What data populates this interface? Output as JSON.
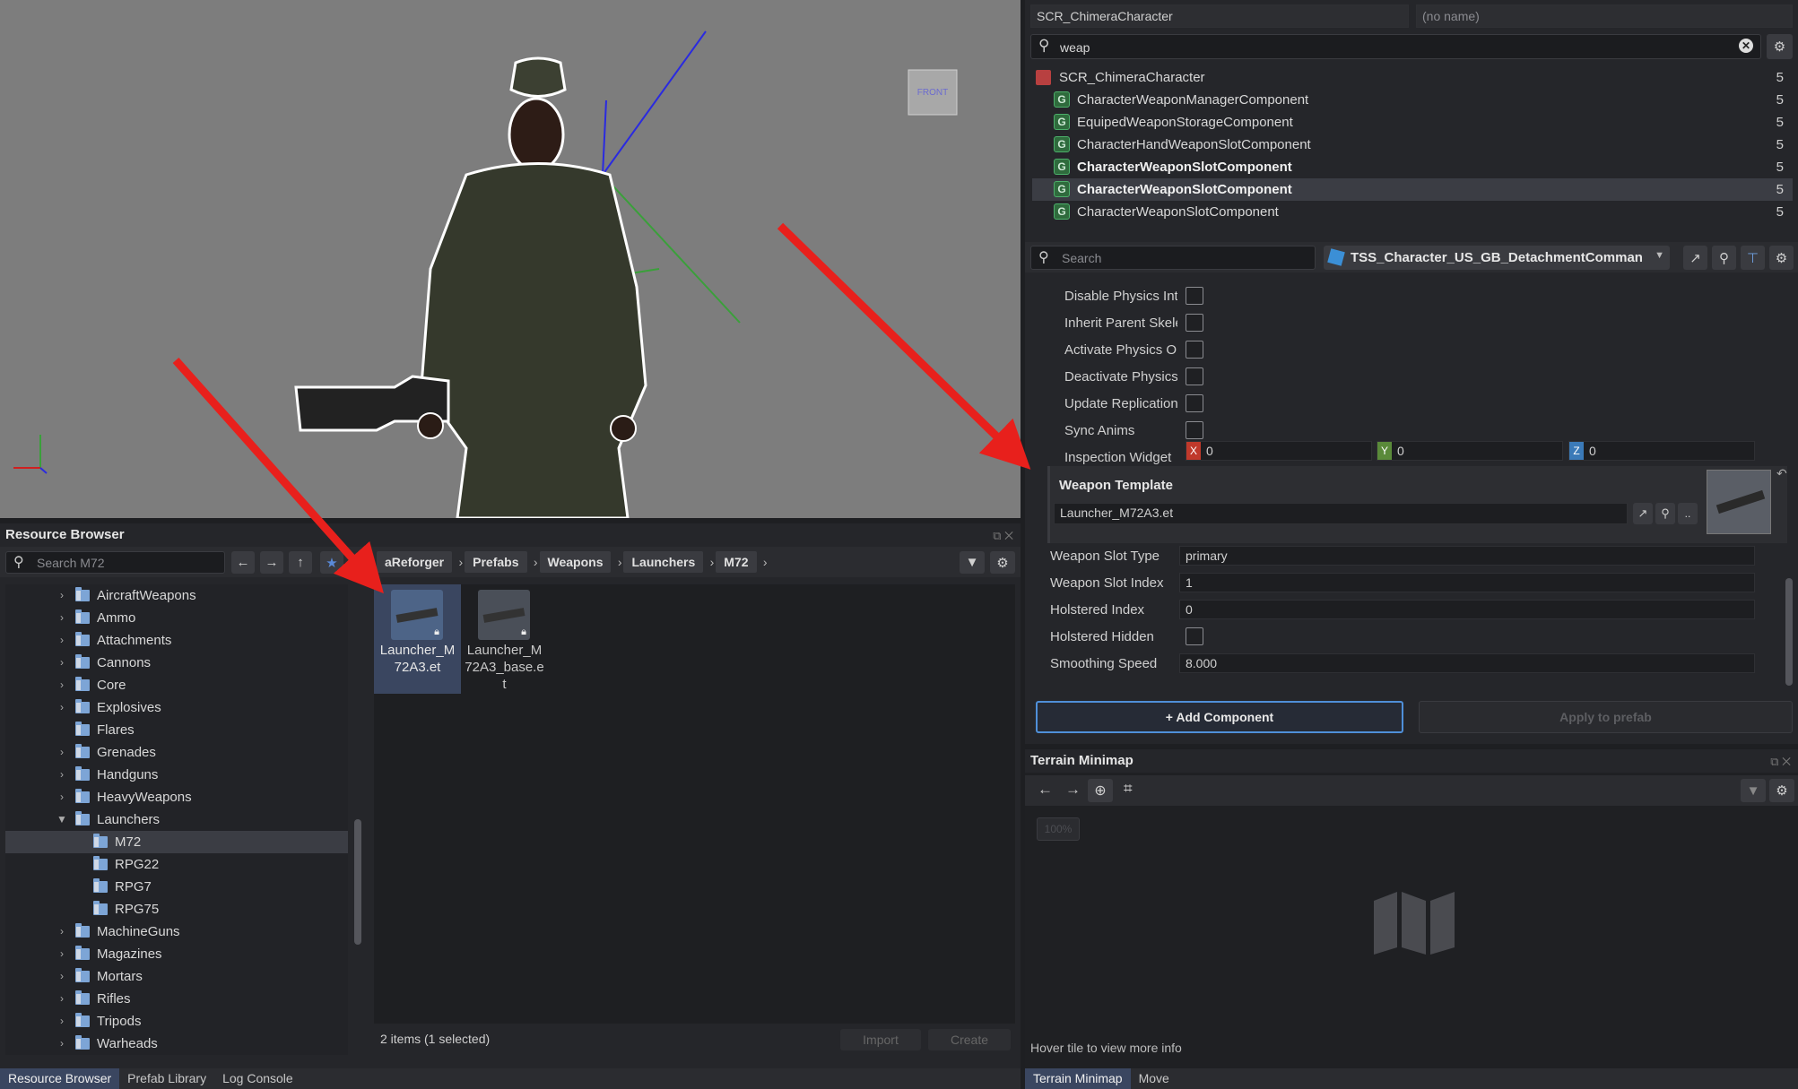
{
  "viewport": {
    "front_label": "FRONT",
    "colors": {
      "bg": "#7d7d7d",
      "annotation_arrow": "#e8201c"
    }
  },
  "resource_browser": {
    "title": "Resource Browser",
    "search_placeholder": "Search M72",
    "breadcrumb": [
      "aReforger",
      "Prefabs",
      "Weapons",
      "Launchers",
      "M72"
    ],
    "tree": [
      {
        "label": "AircraftWeapons",
        "expandable": true,
        "level": 0
      },
      {
        "label": "Ammo",
        "expandable": true,
        "level": 0
      },
      {
        "label": "Attachments",
        "expandable": true,
        "level": 0
      },
      {
        "label": "Cannons",
        "expandable": true,
        "level": 0
      },
      {
        "label": "Core",
        "expandable": true,
        "level": 0
      },
      {
        "label": "Explosives",
        "expandable": true,
        "level": 0
      },
      {
        "label": "Flares",
        "expandable": false,
        "level": 0
      },
      {
        "label": "Grenades",
        "expandable": true,
        "level": 0
      },
      {
        "label": "Handguns",
        "expandable": true,
        "level": 0
      },
      {
        "label": "HeavyWeapons",
        "expandable": true,
        "level": 0
      },
      {
        "label": "Launchers",
        "expandable": true,
        "expanded": true,
        "level": 0
      },
      {
        "label": "M72",
        "expandable": false,
        "level": 1,
        "selected": true
      },
      {
        "label": "RPG22",
        "expandable": false,
        "level": 1
      },
      {
        "label": "RPG7",
        "expandable": false,
        "level": 1
      },
      {
        "label": "RPG75",
        "expandable": false,
        "level": 1
      },
      {
        "label": "MachineGuns",
        "expandable": true,
        "level": 0
      },
      {
        "label": "Magazines",
        "expandable": true,
        "level": 0
      },
      {
        "label": "Mortars",
        "expandable": true,
        "level": 0
      },
      {
        "label": "Rifles",
        "expandable": true,
        "level": 0
      },
      {
        "label": "Tripods",
        "expandable": true,
        "level": 0
      },
      {
        "label": "Warheads",
        "expandable": true,
        "level": 0
      }
    ],
    "files": [
      {
        "name": "Launcher_M72A3.et",
        "selected": true
      },
      {
        "name": "Launcher_M72A3_base.et",
        "selected": false
      }
    ],
    "status": "2 items (1 selected)",
    "import_label": "Import",
    "create_label": "Create"
  },
  "bottom_tabs_left": [
    "Resource Browser",
    "Prefab Library",
    "Log Console"
  ],
  "bottom_tabs_right": [
    "Terrain Minimap",
    "Move"
  ],
  "hierarchy": {
    "class_field": "SCR_ChimeraCharacter",
    "name_placeholder": "(no name)",
    "filter_value": "weap",
    "entities": [
      {
        "label": "SCR_ChimeraCharacter",
        "count": "5",
        "type": "entity",
        "bold": false
      },
      {
        "label": "CharacterWeaponManagerComponent",
        "count": "5",
        "type": "component",
        "bold": false
      },
      {
        "label": "EquipedWeaponStorageComponent",
        "count": "5",
        "type": "component",
        "bold": false
      },
      {
        "label": "CharacterHandWeaponSlotComponent",
        "count": "5",
        "type": "component",
        "bold": false
      },
      {
        "label": "CharacterWeaponSlotComponent",
        "count": "5",
        "type": "component",
        "bold": true
      },
      {
        "label": "CharacterWeaponSlotComponent",
        "count": "5",
        "type": "component",
        "bold": true,
        "selected": true
      },
      {
        "label": "CharacterWeaponSlotComponent",
        "count": "5",
        "type": "component",
        "bold": false
      }
    ]
  },
  "inspector": {
    "search_placeholder": "Search",
    "prefab_name": "TSS_Character_US_GB_DetachmentComman",
    "bool_props": [
      "Disable Physics Inte",
      "Inherit Parent Skele",
      "Activate Physics Or",
      "Deactivate Physics",
      "Update Replication",
      "Sync Anims"
    ],
    "inspection_widget": {
      "label": "Inspection Widget",
      "x_label": "X",
      "x": "0",
      "y_label": "Y",
      "y": "0",
      "z_label": "Z",
      "z": "0"
    },
    "weapon_template": {
      "label": "Weapon Template",
      "value": "Launcher_M72A3.et",
      "more": ".."
    },
    "props": [
      {
        "label": "Weapon Slot Type",
        "value": "primary"
      },
      {
        "label": "Weapon Slot Index",
        "value": "1"
      },
      {
        "label": "Holstered Index",
        "value": "0"
      },
      {
        "label": "Holstered Hidden",
        "value": null
      },
      {
        "label": "Smoothing Speed",
        "value": "8.000"
      }
    ],
    "add_component": "+ Add Component",
    "apply_prefab": "Apply to prefab"
  },
  "minimap": {
    "title": "Terrain Minimap",
    "zoom": "100%",
    "hint": "Hover tile to view more info"
  }
}
